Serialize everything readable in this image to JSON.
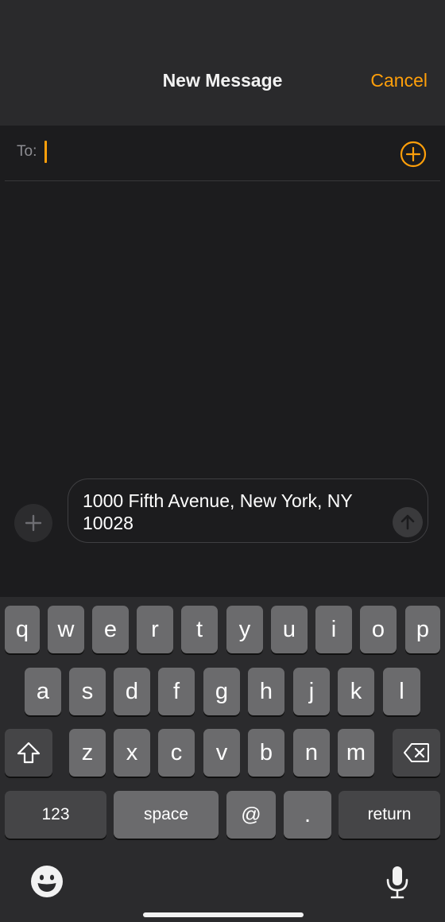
{
  "header": {
    "title": "New Message",
    "cancel_label": "Cancel"
  },
  "recipient": {
    "label": "To:",
    "value": ""
  },
  "compose": {
    "text": "1000 Fifth Avenue, New York, NY\n10028"
  },
  "keyboard": {
    "row1": [
      "q",
      "w",
      "e",
      "r",
      "t",
      "y",
      "u",
      "i",
      "o",
      "p"
    ],
    "row2": [
      "a",
      "s",
      "d",
      "f",
      "g",
      "h",
      "j",
      "k",
      "l"
    ],
    "row3": [
      "z",
      "x",
      "c",
      "v",
      "b",
      "n",
      "m"
    ],
    "bottom": {
      "numbers": "123",
      "space": "space",
      "at": "@",
      "period": ".",
      "return": "return"
    }
  },
  "icons": {
    "add_contact": "plus-circle-icon",
    "attach": "plus-icon",
    "send": "arrow-up-icon",
    "shift": "shift-icon",
    "delete": "delete-backspace-icon",
    "emoji": "emoji-icon",
    "dictation": "microphone-icon"
  },
  "colors": {
    "accent": "#ff9f0a",
    "background": "#1c1c1e",
    "key": "#6b6b6d",
    "key_dark": "#454547"
  }
}
